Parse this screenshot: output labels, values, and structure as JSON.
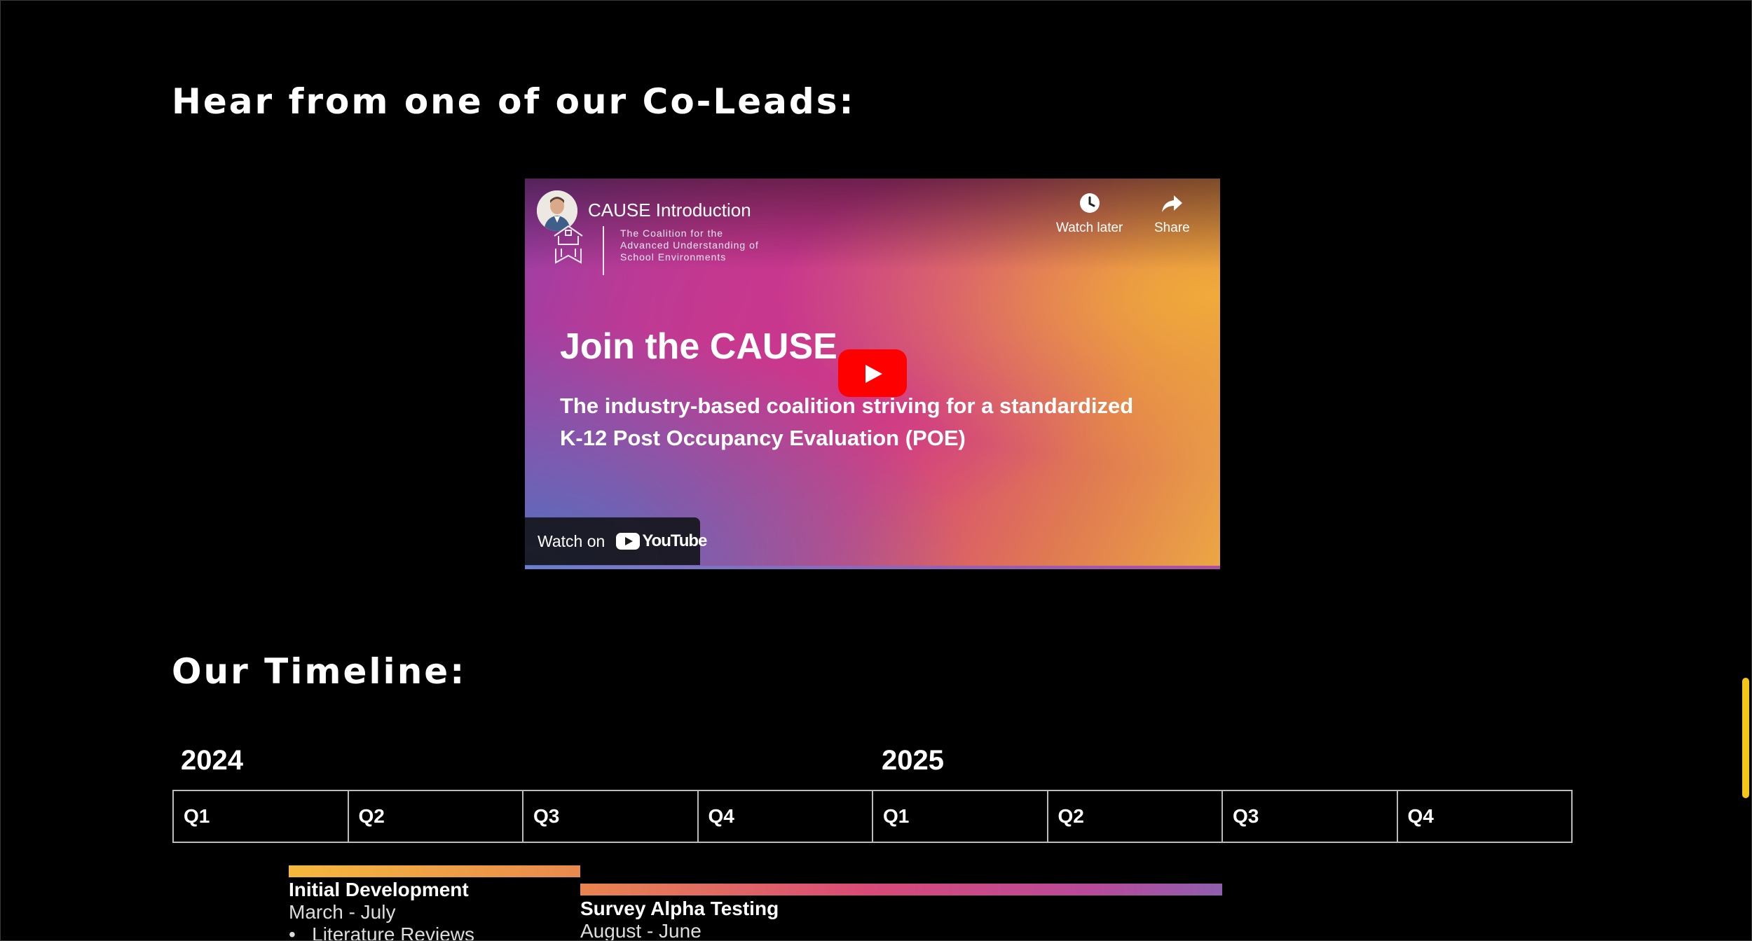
{
  "sections": {
    "coleads_title": "Hear from one of our Co-Leads:",
    "timeline_title": "Our Timeline:"
  },
  "video": {
    "title": "CAUSE Introduction",
    "org_name": "The Coalition for the\nAdvanced Understanding of\nSchool Environments",
    "watch_later_label": "Watch later",
    "share_label": "Share",
    "heading": "Join the CAUSE",
    "subheading": "The industry-based coalition striving for a standardized K-12 Post Occupancy Evaluation (POE)",
    "watch_on_label": "Watch on",
    "youtube_wordmark": "YouTube",
    "play_button_color": "#ff0000"
  },
  "timeline": {
    "years": [
      "2024",
      "2025"
    ],
    "quarters": [
      "Q1",
      "Q2",
      "Q3",
      "Q4",
      "Q1",
      "Q2",
      "Q3",
      "Q4"
    ],
    "phases": [
      {
        "title": "Initial Development",
        "dates": "March - July",
        "bullet": "Literature Reviews"
      },
      {
        "title": "Survey  Alpha Testing",
        "dates": "August - June"
      }
    ]
  },
  "colors": {
    "background": "#000000",
    "scrollbar_thumb": "#f5c518"
  }
}
